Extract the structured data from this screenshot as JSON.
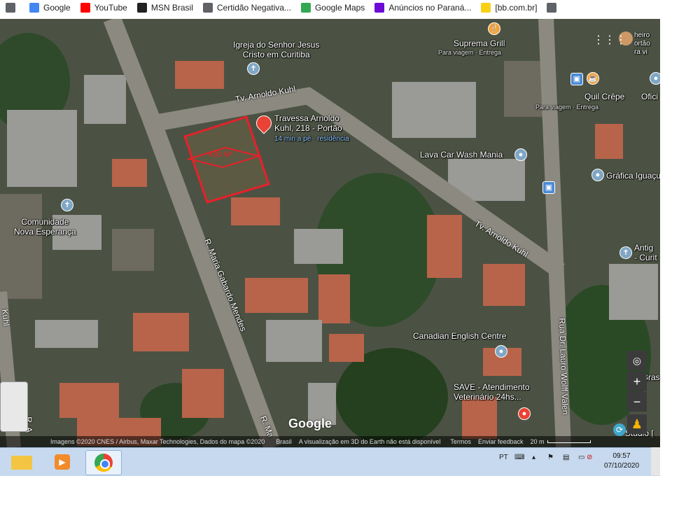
{
  "bookmarks": [
    {
      "label": "",
      "icon": "app-grid-icon",
      "color": "#5f6368"
    },
    {
      "label": "Google",
      "icon": "google-icon",
      "color": "#4285f4"
    },
    {
      "label": "YouTube",
      "icon": "youtube-icon",
      "color": "#ff0000"
    },
    {
      "label": "MSN Brasil",
      "icon": "msn-icon",
      "color": "#222222"
    },
    {
      "label": "Certidão Negativa...",
      "icon": "globe-icon",
      "color": "#5f6368"
    },
    {
      "label": "Google Maps",
      "icon": "maps-pin-icon",
      "color": "#34a853"
    },
    {
      "label": "Anúncios no Paraná...",
      "icon": "olx-icon",
      "color": "#6e0ad6"
    },
    {
      "label": "[bb.com.br]",
      "icon": "bb-icon",
      "color": "#f8d117"
    },
    {
      "label": "",
      "icon": "globe-icon",
      "color": "#5f6368"
    }
  ],
  "map": {
    "places": {
      "igreja": "Igreja do Senhor Jesus\nCristo em Curitiba",
      "travessa": "Travessa Arnoldo\nKuhl, 218 - Portão",
      "travessa_sub": "14 min a pé · residência",
      "suprema": "Suprema Grill",
      "suprema_sub": "Para viagem · Entrega",
      "quil": "Quil Crêpe",
      "quil_sub": "Para viagem · Entrega",
      "ofic": "Ofici",
      "lava": "Lava Car Wash Mania",
      "grafica": "Gráfica Iguaçu",
      "comunidade": "Comunidade\nNova Esperança",
      "antiga": "Antig\n- Curit",
      "canadian": "Canadian English Centre",
      "save": "SAVE - Atendimento\nVeterinário 24hs...",
      "bras": "Bras",
      "studio": "Studio [",
      "cheiro": "heiro\nortão\nra vi"
    },
    "roads": {
      "tv_arnoldo_1": "Tv. Arnoldo Kuhl",
      "tv_arnoldo_2": "Tv. Arnoldo Kuhl",
      "maria": "R. Maria Gabardo Mendes",
      "maria_short": "R. Ma",
      "lauro": "Rua Dr. Lauro Wolff Valen",
      "left_a": "R. A",
      "left_kuhl": "Kuhl"
    },
    "lot_area": "430 M²",
    "google_logo": "Google",
    "footer": {
      "imagery": "Imagens ©2020 CNES / Airbus, Maxar Technologies, Dados do mapa ©2020",
      "country": "Brasil",
      "notice": "A visualização em 3D do Earth não está disponível",
      "terms": "Termos",
      "feedback": "Enviar feedback",
      "scale": "20 m"
    }
  },
  "taskbar": {
    "lang": "PT",
    "time": "09:57",
    "date": "07/10/2020"
  }
}
